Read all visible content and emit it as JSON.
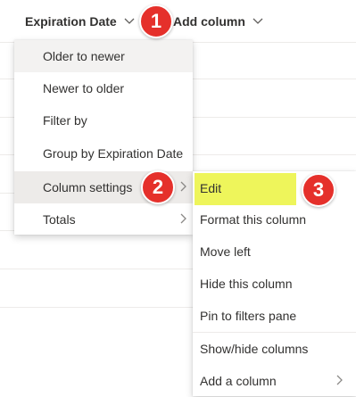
{
  "header": {
    "column_expiration": "Expiration Date",
    "column_add": "Add column"
  },
  "column_menu": {
    "items": [
      {
        "label": "Older to newer"
      },
      {
        "label": "Newer to older"
      },
      {
        "label": "Filter by"
      },
      {
        "label": "Group by Expiration Date"
      },
      {
        "label": "Column settings"
      },
      {
        "label": "Totals"
      }
    ]
  },
  "settings_submenu": {
    "items": [
      {
        "label": "Edit"
      },
      {
        "label": "Format this column"
      },
      {
        "label": "Move left"
      },
      {
        "label": "Hide this column"
      },
      {
        "label": "Pin to filters pane"
      },
      {
        "label": "Show/hide columns"
      },
      {
        "label": "Add a column"
      }
    ]
  },
  "annotations": {
    "step1": "1",
    "step2": "2",
    "step3": "3"
  },
  "colors": {
    "step_badge": "#e5302b",
    "edit_highlight": "#eef55b"
  }
}
